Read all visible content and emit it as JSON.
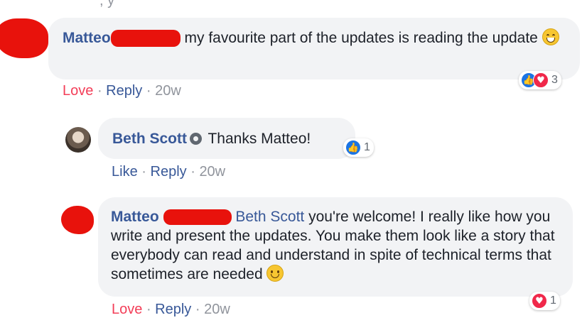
{
  "top_fragment": ", y",
  "comments": [
    {
      "author": "Matteo",
      "text": "my favourite part of the updates is reading the update",
      "emoji_icon": "grinning-face-icon",
      "reactions": {
        "icons": [
          "like-icon",
          "love-icon"
        ],
        "count": "3"
      },
      "actions": {
        "primary": "Love",
        "reply": "Reply",
        "time": "20w"
      }
    },
    {
      "author": "Beth Scott",
      "text": "Thanks Matteo!",
      "badge_icon": "admin-badge-icon",
      "reactions": {
        "icons": [
          "like-icon"
        ],
        "count": "1"
      },
      "actions": {
        "primary": "Like",
        "reply": "Reply",
        "time": "20w"
      }
    },
    {
      "author": "Matteo",
      "mention": "Beth Scott",
      "text": "you're welcome! I really like how you write and present the updates. You make them look like a story that everybody can read and understand in spite of technical terms that sometimes are needed",
      "emoji_icon": "smiling-face-icon",
      "reactions": {
        "icons": [
          "love-icon"
        ],
        "count": "1"
      },
      "actions": {
        "primary": "Love",
        "reply": "Reply",
        "time": "20w"
      }
    }
  ],
  "separator": "·",
  "colors": {
    "author_blue": "#385898",
    "love_red": "#f33e58",
    "meta_gray": "#90949c",
    "bubble_bg": "#f2f3f5",
    "redaction_red": "#e8120c"
  }
}
